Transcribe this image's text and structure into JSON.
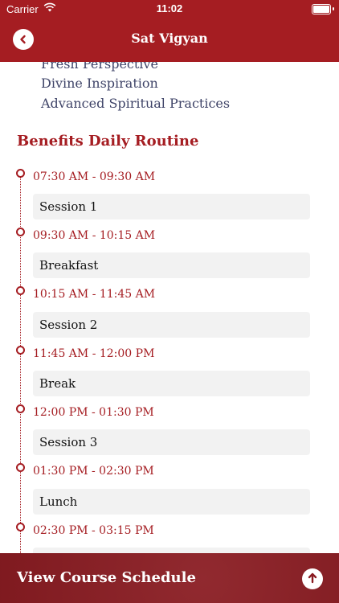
{
  "status_bar": {
    "carrier": "Carrier",
    "time": "11:02"
  },
  "header": {
    "title": "Sat Vigyan"
  },
  "practices": [
    "Fresh Perspective",
    "Divine Inspiration",
    "Advanced Spiritual Practices"
  ],
  "routine": {
    "title": "Benefits Daily Routine",
    "items": [
      {
        "time": "07:30 AM - 09:30 AM",
        "activity": "Session 1"
      },
      {
        "time": "09:30 AM - 10:15 AM",
        "activity": "Breakfast"
      },
      {
        "time": "10:15 AM - 11:45 AM",
        "activity": "Session 2"
      },
      {
        "time": "11:45 AM - 12:00 PM",
        "activity": "Break"
      },
      {
        "time": "12:00 PM - 01:30 PM",
        "activity": "Session 3"
      },
      {
        "time": "01:30 PM - 02:30 PM",
        "activity": "Lunch"
      },
      {
        "time": "02:30 PM - 03:15 PM",
        "activity": ""
      }
    ]
  },
  "bottom_bar": {
    "label": "View Course Schedule"
  },
  "colors": {
    "brand": "#a51d22",
    "bottom_bar": "#8a1c22",
    "card": "#f2f2f2",
    "practice_text": "#3f4468"
  },
  "icons": {
    "back": "chevron-left-icon",
    "scroll_up": "arrow-up-icon"
  }
}
